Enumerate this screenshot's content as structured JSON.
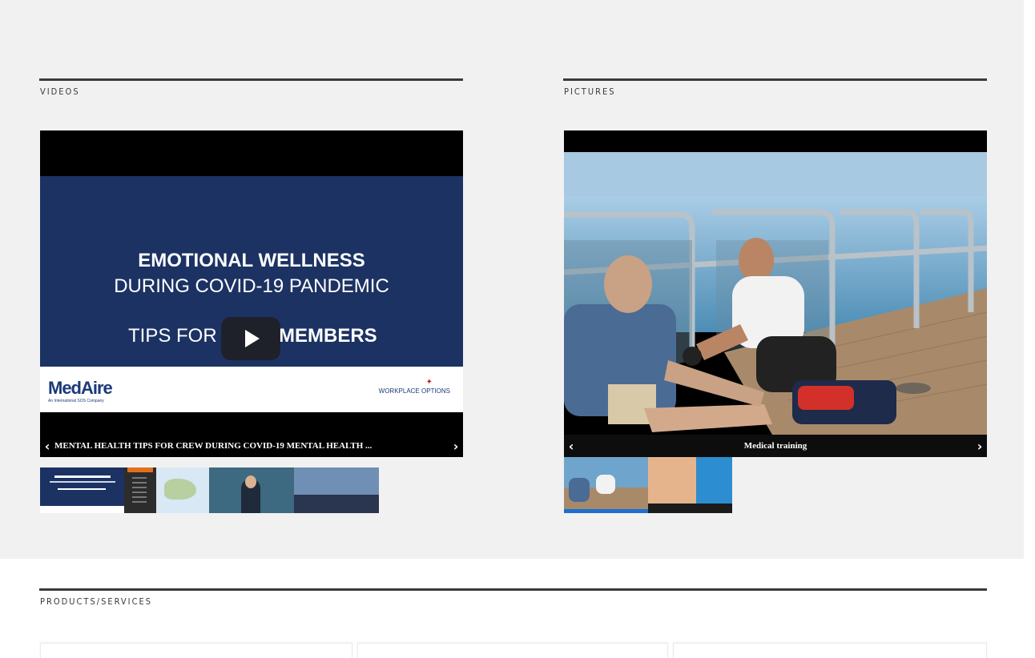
{
  "videos": {
    "section_label": "VIDEOS",
    "slide": {
      "line1": "EMOTIONAL WELLNESS",
      "line2": "DURING COVID-19 PANDEMIC",
      "line3_left": "TIPS FOR",
      "line3_right": "MEMBERS",
      "brand": "MedAire",
      "brand_sub": "An International SOS Company",
      "partner": "WORKPLACE OPTIONS"
    },
    "caption": "MENTAL HEALTH TIPS FOR CREW DURING COVID-19 MENTAL HEALTH ...",
    "thumbnails": [
      "video-thumb-emotional-wellness",
      "video-thumb-software",
      "video-thumb-map",
      "video-thumb-presenter",
      "video-thumb-office"
    ]
  },
  "pictures": {
    "section_label": "PICTURES",
    "caption": "Medical training",
    "thumbnails": [
      "picture-thumb-medical-training",
      "picture-thumb-medaire"
    ]
  },
  "products": {
    "section_label": "PRODUCTS/SERVICES"
  },
  "icons": {
    "prev": "‹",
    "next": "›"
  },
  "colors": {
    "band": "#f1f1f1",
    "slide_navy": "#1c3263",
    "brand_blue": "#1a3a7a"
  }
}
